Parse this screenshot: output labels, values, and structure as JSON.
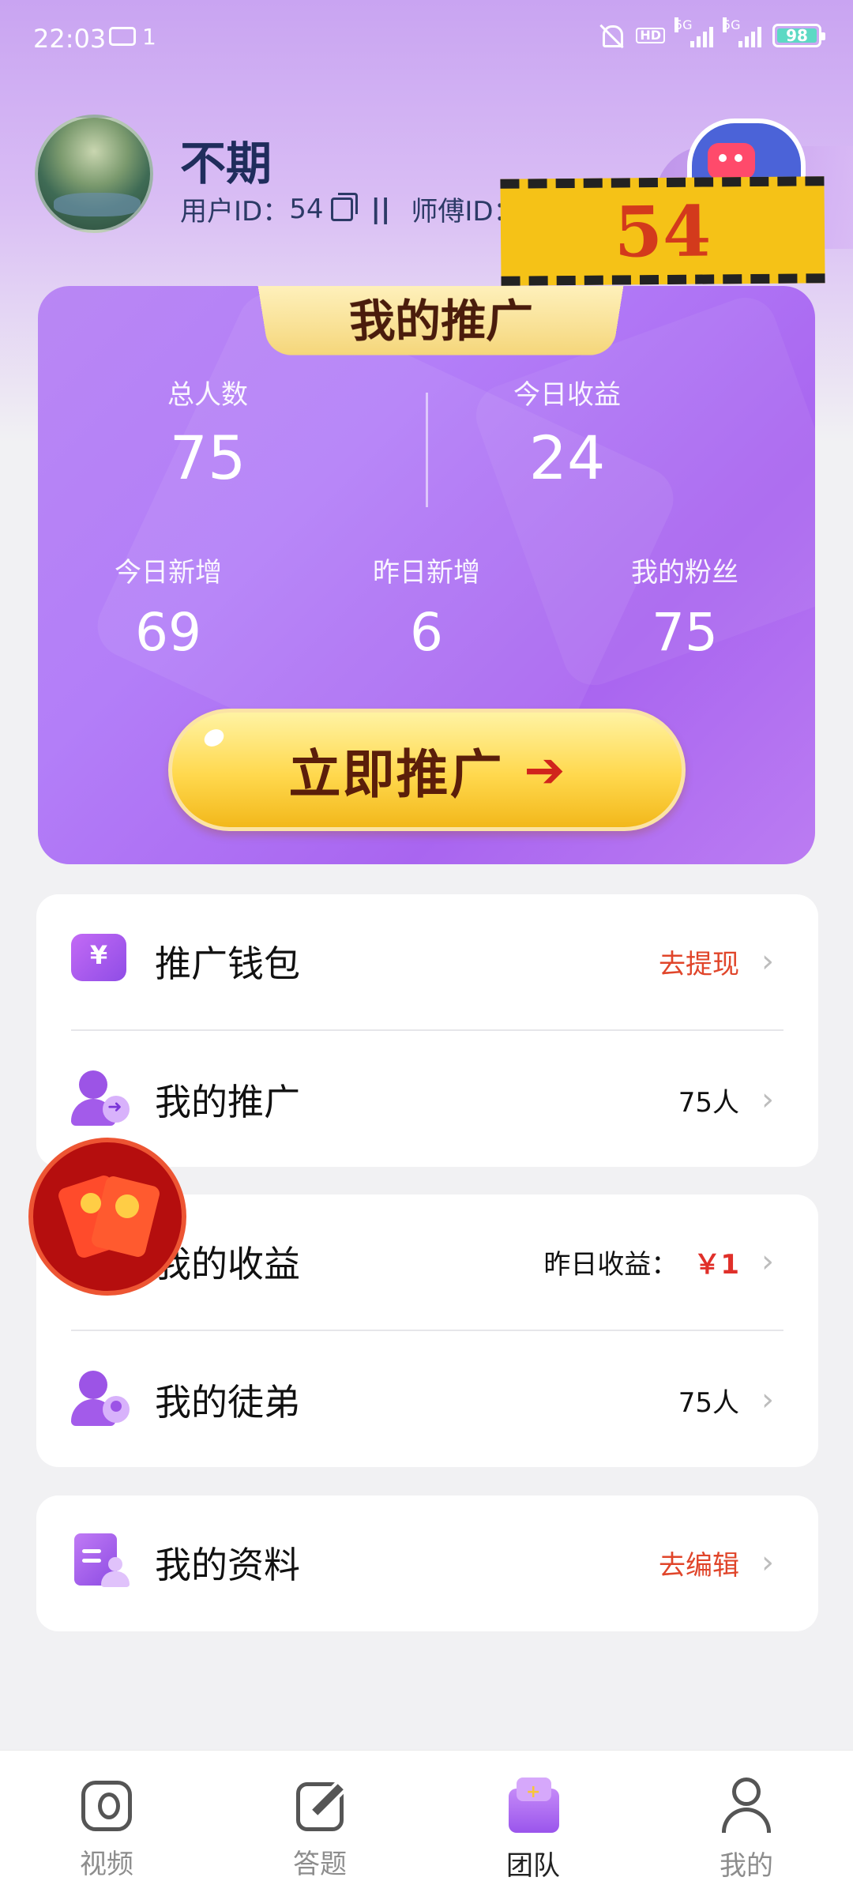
{
  "status_bar": {
    "time": "22:03",
    "notification_count": "1",
    "hd_label": "HD",
    "signal1_label": "5G",
    "signal2_label": "5G",
    "battery": "98"
  },
  "profile": {
    "name": "不期",
    "user_id_label": "用户ID：",
    "user_id": "54",
    "separator": "||",
    "master_id_label": "师傅ID：",
    "overlay_text": "54"
  },
  "promo": {
    "tab_title": "我的推广",
    "total_label": "总人数",
    "total_value": "75",
    "today_income_label": "今日收益",
    "today_income_value": "24",
    "today_new_label": "今日新增",
    "today_new_value": "69",
    "yesterday_new_label": "昨日新增",
    "yesterday_new_value": "6",
    "fans_label": "我的粉丝",
    "fans_value": "75",
    "button_label": "立即推广",
    "button_arrow": "➔"
  },
  "menu": {
    "wallet": {
      "title": "推广钱包",
      "action": "去提现",
      "icon_text": "¥"
    },
    "promotion": {
      "title": "我的推广",
      "value": "75人"
    },
    "income": {
      "title": "我的收益",
      "label": "昨日收益：",
      "value": "￥1"
    },
    "apprentice": {
      "title": "我的徒弟",
      "value": "75人"
    },
    "profile": {
      "title": "我的资料",
      "action": "去编辑"
    },
    "chevron": "›"
  },
  "nav": {
    "video": "视频",
    "quiz": "答题",
    "team": "团队",
    "me": "我的",
    "active": "团队"
  },
  "colors": {
    "accent_purple": "#a965f0",
    "action_red": "#e0452a",
    "button_yellow": "#ffd84d"
  }
}
